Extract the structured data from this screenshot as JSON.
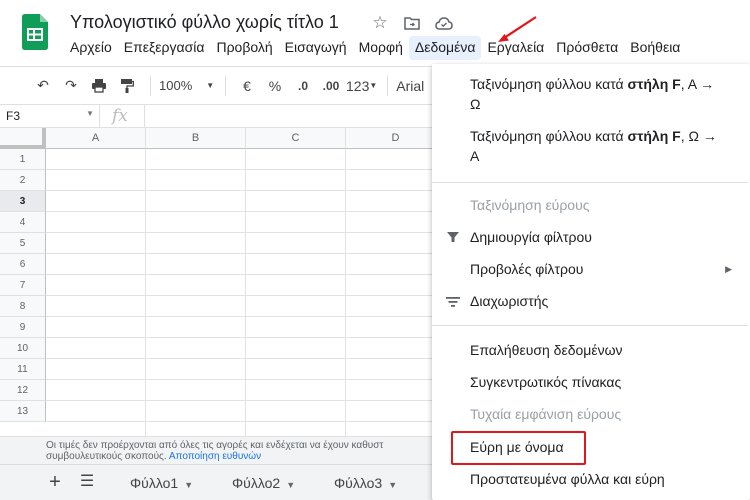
{
  "app": {
    "title": "Υπολογιστικό φύλλο χωρίς τίτλο 1",
    "title_icons": [
      "star-icon",
      "move-folder-icon",
      "cloud-status-icon"
    ]
  },
  "menubar": [
    {
      "label": "Αρχείο"
    },
    {
      "label": "Επεξεργασία"
    },
    {
      "label": "Προβολή"
    },
    {
      "label": "Εισαγωγή"
    },
    {
      "label": "Μορφή"
    },
    {
      "label": "Δεδομένα",
      "active": true
    },
    {
      "label": "Εργαλεία"
    },
    {
      "label": "Πρόσθετα"
    },
    {
      "label": "Βοήθεια"
    }
  ],
  "toolbar": {
    "zoom": "100%",
    "currency": "€",
    "percent": "%",
    "decrease_decimals": ".0",
    "increase_decimals": ".00",
    "more_formats": "123",
    "font": "Arial"
  },
  "formula_bar": {
    "cell_ref": "F3",
    "fx": "fx"
  },
  "grid": {
    "columns": [
      "A",
      "B",
      "C",
      "D"
    ],
    "rows": [
      "1",
      "2",
      "3",
      "4",
      "5",
      "6",
      "7",
      "8",
      "9",
      "10",
      "11",
      "12",
      "13"
    ],
    "selected_row": "3"
  },
  "notice": {
    "text": "Οι τιμές δεν προέρχονται από όλες τις αγορές και ενδέχεται να έχουν καθυστ",
    "text2": "συμβουλευτικούς σκοπούς.",
    "link": "Αποποίηση ευθυνών"
  },
  "sheets": [
    {
      "label": "Φύλλο1"
    },
    {
      "label": "Φύλλο2"
    },
    {
      "label": "Φύλλο3"
    }
  ],
  "data_menu": {
    "sort_sheet_az_prefix": "Ταξινόμηση φύλλου κατά ",
    "sort_sheet_az_bold": "στήλη F",
    "sort_sheet_az_suffix": ", A →",
    "sort_sheet_az_line2": "Ω",
    "sort_sheet_za_prefix": "Ταξινόμηση φύλλου κατά ",
    "sort_sheet_za_bold": "στήλη F",
    "sort_sheet_za_suffix": ", Ω →",
    "sort_sheet_za_line2": "A",
    "sort_range": "Ταξινόμηση εύρους",
    "create_filter": "Δημιουργία φίλτρου",
    "filter_views": "Προβολές φίλτρου",
    "slicer": "Διαχωριστής",
    "data_validation": "Επαλήθευση δεδομένων",
    "pivot_table": "Συγκεντρωτικός πίνακας",
    "randomize_range": "Τυχαία εμφάνιση εύρους",
    "named_ranges": "Εύρη με όνομα",
    "protected_sheets": "Προστατευμένα φύλλα και εύρη"
  },
  "colors": {
    "highlight": "#e3161a",
    "active_menu_bg": "#e8f0fe",
    "link": "#1a73e8",
    "logo": "#0f9d58"
  }
}
